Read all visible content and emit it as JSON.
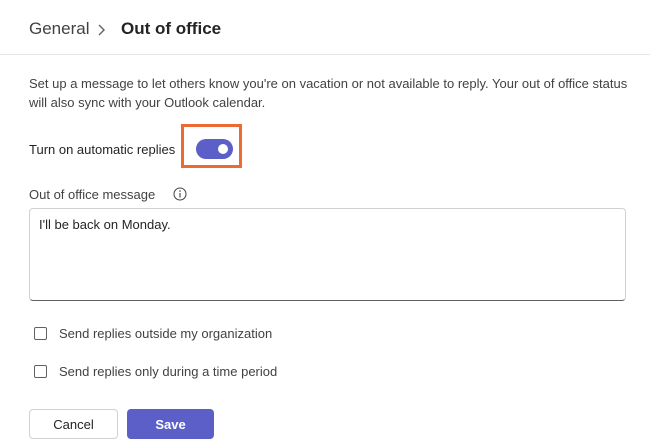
{
  "header": {
    "breadcrumb_parent": "General",
    "breadcrumb_current": "Out of office"
  },
  "description": "Set up a message to let others know you're on vacation or not available to reply. Your out of office status will also sync with your Outlook calendar.",
  "automatic_replies": {
    "label": "Turn on automatic replies",
    "enabled": true
  },
  "message": {
    "label": "Out of office message",
    "value": "I'll be back on Monday."
  },
  "options": [
    {
      "label": "Send replies outside my organization",
      "checked": false
    },
    {
      "label": "Send replies only during a time period",
      "checked": false
    }
  ],
  "buttons": {
    "cancel": "Cancel",
    "save": "Save"
  },
  "colors": {
    "accent": "#5b5fc7",
    "highlight": "#ed6a32"
  },
  "icons": [
    "chevron-right-icon",
    "info-icon"
  ]
}
